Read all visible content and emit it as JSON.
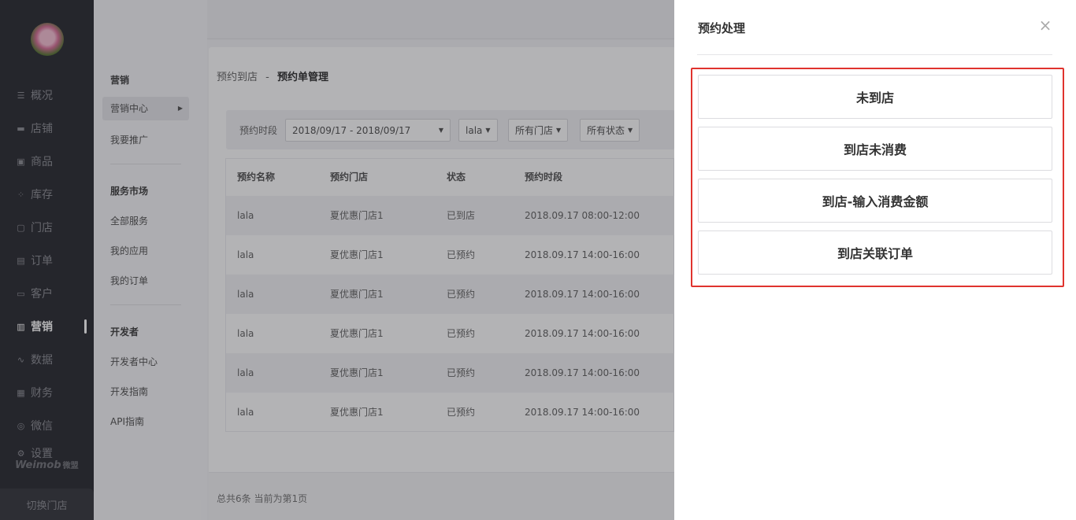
{
  "sidebar": {
    "items": [
      {
        "icon": "list-icon",
        "glyph": "☰",
        "label": "概况"
      },
      {
        "icon": "store-icon",
        "glyph": "▬",
        "label": "店铺"
      },
      {
        "icon": "product-icon",
        "glyph": "▣",
        "label": "商品"
      },
      {
        "icon": "inventory-icon",
        "glyph": "⁘",
        "label": "库存"
      },
      {
        "icon": "shop-icon",
        "glyph": "▢",
        "label": "门店"
      },
      {
        "icon": "order-icon",
        "glyph": "▤",
        "label": "订单"
      },
      {
        "icon": "customer-icon",
        "glyph": "▭",
        "label": "客户"
      },
      {
        "icon": "marketing-icon",
        "glyph": "▥",
        "label": "营销",
        "active": true
      },
      {
        "icon": "data-icon",
        "glyph": "∿",
        "label": "数据"
      },
      {
        "icon": "finance-icon",
        "glyph": "▦",
        "label": "财务"
      },
      {
        "icon": "wechat-icon",
        "glyph": "◎",
        "label": "微信"
      },
      {
        "icon": "settings-icon",
        "glyph": "⚙",
        "label": "设置"
      }
    ],
    "brand": "Weimob",
    "brand_cn": "微盟",
    "switch_store": "切换门店"
  },
  "submenu": {
    "group1": "营销",
    "group1_items": [
      "营销中心",
      "我要推广"
    ],
    "group2": "服务市场",
    "group2_items": [
      "全部服务",
      "我的应用",
      "我的订单"
    ],
    "group3": "开发者",
    "group3_items": [
      "开发者中心",
      "开发指南",
      "API指南"
    ]
  },
  "breadcrumb": {
    "parent": "预约到店",
    "sep": "-",
    "current": "预约单管理"
  },
  "filters": {
    "time_label": "预约时段",
    "date_range": "2018/09/17 - 2018/09/17",
    "name_select": "lala",
    "store_select": "所有门店",
    "status_select": "所有状态"
  },
  "table": {
    "headers": [
      "预约名称",
      "预约门店",
      "状态",
      "预约时段"
    ],
    "rows": [
      [
        "lala",
        "夏优惠门店1",
        "已到店",
        "2018.09.17 08:00-12:00"
      ],
      [
        "lala",
        "夏优惠门店1",
        "已预约",
        "2018.09.17 14:00-16:00"
      ],
      [
        "lala",
        "夏优惠门店1",
        "已预约",
        "2018.09.17 14:00-16:00"
      ],
      [
        "lala",
        "夏优惠门店1",
        "已预约",
        "2018.09.17 14:00-16:00"
      ],
      [
        "lala",
        "夏优惠门店1",
        "已预约",
        "2018.09.17 14:00-16:00"
      ],
      [
        "lala",
        "夏优惠门店1",
        "已预约",
        "2018.09.17 14:00-16:00"
      ]
    ]
  },
  "pagination": {
    "summary": "总共6条 当前为第1页"
  },
  "drawer": {
    "title": "预约处理",
    "close_glyph": "×",
    "options": [
      "未到店",
      "到店未消费",
      "到店-输入消费金额",
      "到店关联订单"
    ]
  },
  "colors": {
    "sidebar_bg": "#2f3036",
    "highlight": "#e0332e"
  }
}
